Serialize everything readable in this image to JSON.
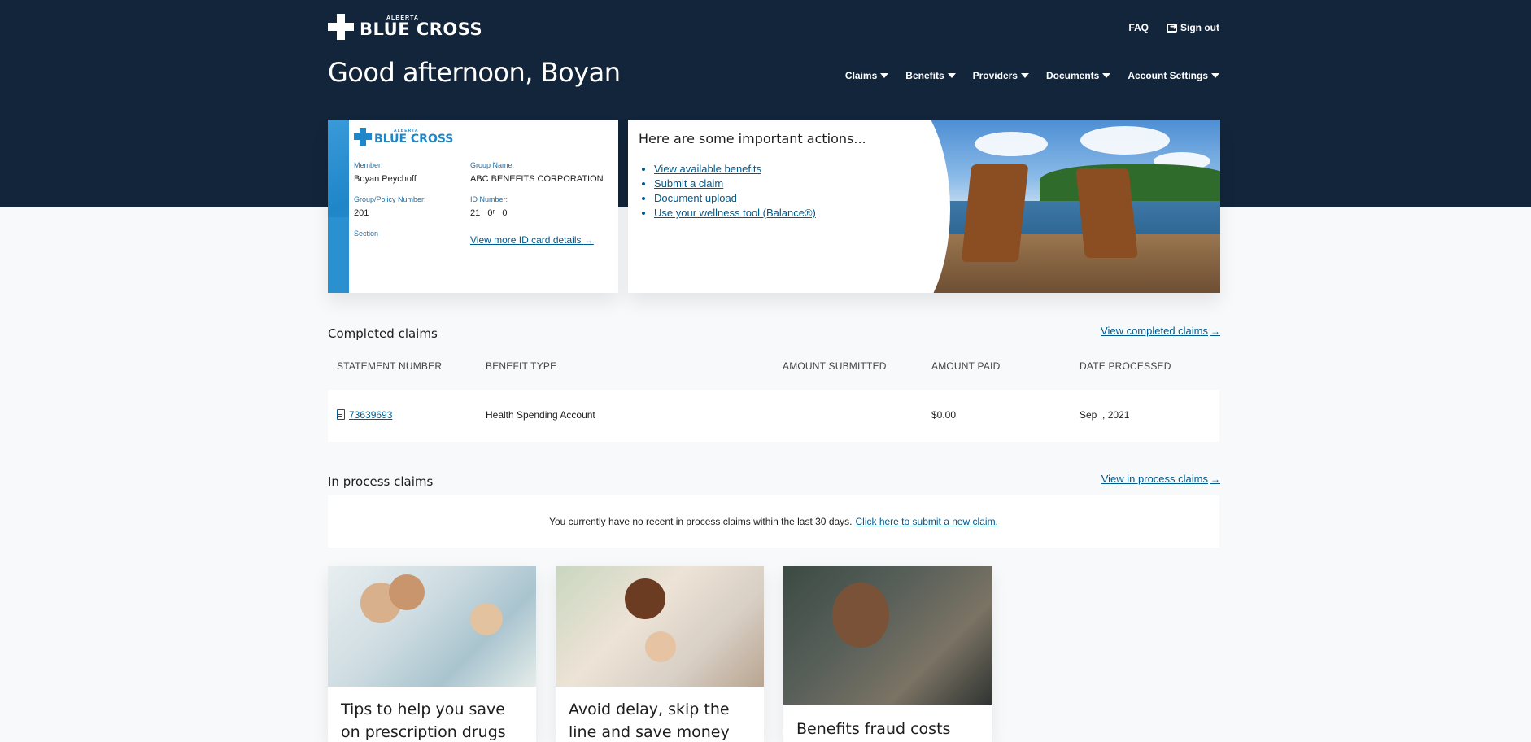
{
  "brand": {
    "small": "ALBERTA",
    "big": "BLUE CROSS"
  },
  "toplinks": {
    "faq": "FAQ",
    "signout": "Sign out"
  },
  "greeting": "Good afternoon, Boyan",
  "nav": [
    "Claims",
    "Benefits",
    "Providers",
    "Documents",
    "Account Settings"
  ],
  "idcard": {
    "member_label": "Member:",
    "member": "Boyan Peychoff",
    "group_name_label": "Group Name:",
    "group_name": "ABC BENEFITS CORPORATION",
    "policy_label": "Group/Policy Number:",
    "policy": "201",
    "id_label": "ID Number:",
    "id": "21   0ʳ   0",
    "section_label": "Section",
    "more_link": "View more ID card details"
  },
  "actions": {
    "title": "Here are some important actions...",
    "links": [
      "View available benefits",
      "Submit a claim",
      "Document upload",
      "Use your wellness tool (Balance®)"
    ]
  },
  "completed": {
    "title": "Completed claims",
    "link": "View completed claims",
    "headers": [
      "STATEMENT NUMBER",
      "BENEFIT TYPE",
      "AMOUNT SUBMITTED",
      "AMOUNT PAID",
      "DATE PROCESSED"
    ],
    "rows": [
      {
        "statement": "73639693",
        "benefit": "Health Spending Account",
        "submitted": "",
        "paid": "$0.00",
        "date": "Sep  , 2021"
      }
    ]
  },
  "inprocess": {
    "title": "In process claims",
    "link": "View in process claims",
    "message": "You currently have no recent in process claims within the last 30 days.",
    "message_link": "Click here to submit a new claim."
  },
  "cards": [
    {
      "title": "Tips to help you save on prescription drugs"
    },
    {
      "title": "Avoid delay, skip the line and save money with our"
    },
    {
      "title": "Benefits fraud costs more"
    }
  ]
}
